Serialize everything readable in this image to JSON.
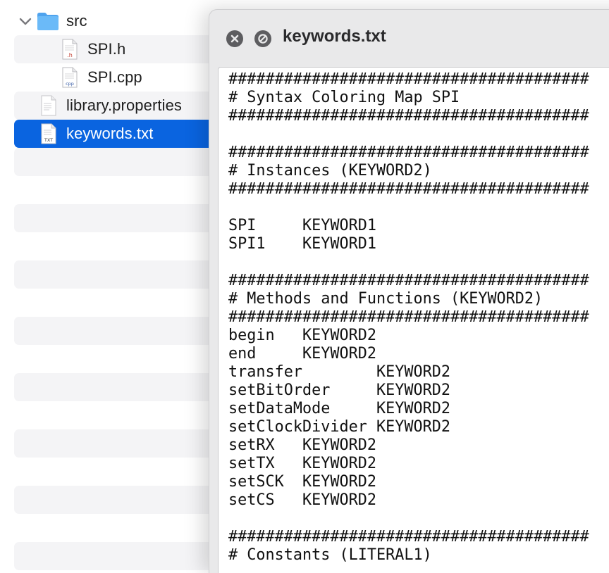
{
  "finder": {
    "rows": [
      {
        "label": "src",
        "kind": "folder",
        "expanded": true,
        "icon": "folder-icon"
      },
      {
        "label": "SPI.h",
        "kind": "file",
        "icon": "h-file-icon",
        "badge": ".h"
      },
      {
        "label": "SPI.cpp",
        "kind": "file",
        "icon": "cpp-file-icon",
        "badge": "cpp"
      },
      {
        "label": "library.properties",
        "kind": "file",
        "icon": "text-file-icon"
      },
      {
        "label": "keywords.txt",
        "kind": "file",
        "icon": "txt-file-icon",
        "badge": "TXT",
        "selected": true
      }
    ]
  },
  "quicklook": {
    "title": "keywords.txt",
    "close_icon": "close-icon",
    "fullscreen_icon": "no-entry-icon",
    "content": "#######################################\n# Syntax Coloring Map SPI\n#######################################\n\n#######################################\n# Instances (KEYWORD2)\n#######################################\n\nSPI\tKEYWORD1\nSPI1\tKEYWORD1\n\n#######################################\n# Methods and Functions (KEYWORD2)\n#######################################\nbegin\tKEYWORD2\nend\tKEYWORD2\ntransfer\tKEYWORD2\nsetBitOrder\tKEYWORD2\nsetDataMode\tKEYWORD2\nsetClockDivider\tKEYWORD2\nsetRX\tKEYWORD2\nsetTX\tKEYWORD2\nsetSCK\tKEYWORD2\nsetCS\tKEYWORD2\n\n#######################################\n# Constants (LITERAL1)"
  },
  "colors": {
    "selection": "#0a64e0",
    "folder": "#5fb0f5",
    "stripe": "#f4f4f6"
  }
}
